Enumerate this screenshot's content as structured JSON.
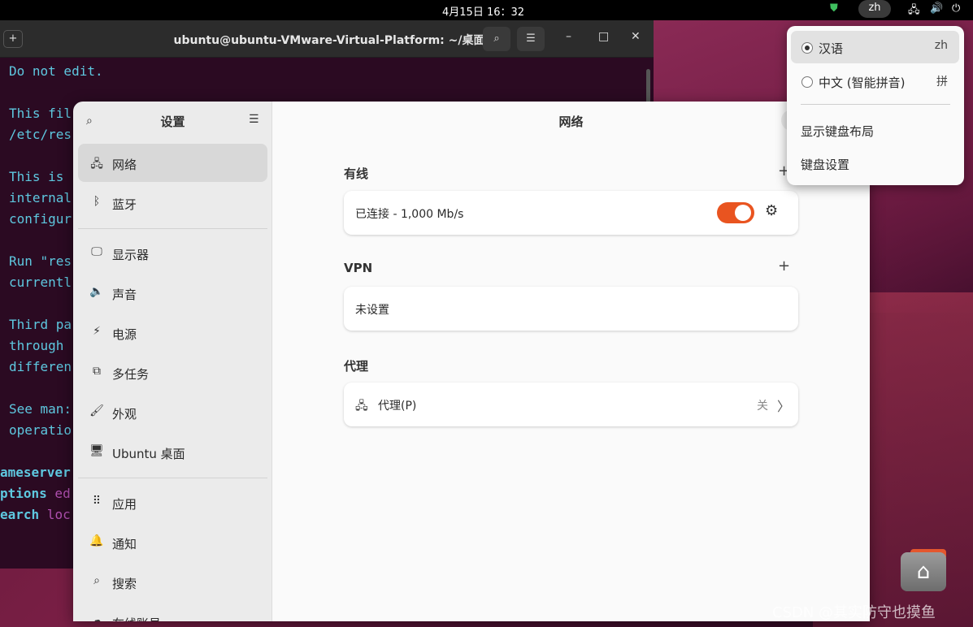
{
  "topbar": {
    "clock": "4月15日  16：32",
    "input_method": "zh"
  },
  "terminal": {
    "title": "ubuntu@ubuntu-VMware-Virtual-Platform: ~/桌面",
    "lines": [
      "Do not edit.",
      "",
      "This fil",
      "/etc/res",
      "",
      "This is ",
      "internal",
      "configur",
      "",
      "Run \"res",
      "currentl",
      "",
      "Third pa",
      "through ",
      "differen",
      "",
      "See man:",
      "operatio"
    ],
    "bold_lines": [
      {
        "kw": "ameserver",
        "val": ""
      },
      {
        "kw": "ptions",
        "val": " ed"
      },
      {
        "kw": "earch",
        "val": " loc"
      }
    ]
  },
  "settings": {
    "sidebar_title": "设置",
    "items": [
      {
        "label": "网络",
        "icon": "network-icon",
        "glyph": "🖧"
      },
      {
        "label": "蓝牙",
        "icon": "bluetooth-icon",
        "glyph": "ᛒ"
      },
      {
        "label": "显示器",
        "icon": "display-icon",
        "glyph": "🖵"
      },
      {
        "label": "声音",
        "icon": "sound-icon",
        "glyph": "🔈"
      },
      {
        "label": "电源",
        "icon": "power-icon",
        "glyph": "⚡"
      },
      {
        "label": "多任务",
        "icon": "multitasking-icon",
        "glyph": "⧉"
      },
      {
        "label": "外观",
        "icon": "appearance-icon",
        "glyph": "🖌"
      },
      {
        "label": "Ubuntu 桌面",
        "icon": "ubuntu-desktop-icon",
        "glyph": "🖥"
      },
      {
        "label": "应用",
        "icon": "apps-icon",
        "glyph": "⠿"
      },
      {
        "label": "通知",
        "icon": "notifications-icon",
        "glyph": "🔔"
      },
      {
        "label": "搜索",
        "icon": "search-icon",
        "glyph": "⌕"
      },
      {
        "label": "在线账号",
        "icon": "online-accounts-icon",
        "glyph": "☁"
      }
    ],
    "page_title": "网络",
    "wired": {
      "heading": "有线",
      "status": "已连接 - 1,000 Mb/s"
    },
    "vpn": {
      "heading": "VPN",
      "status": "未设置"
    },
    "proxy": {
      "heading": "代理",
      "label": "代理(P)",
      "value": "关"
    }
  },
  "popup": {
    "items": [
      {
        "label": "汉语",
        "short": "zh",
        "selected": true
      },
      {
        "label": "中文 (智能拼音)",
        "short": "拼",
        "selected": false
      }
    ],
    "show_layout": "显示键盘布局",
    "keyboard_settings": "键盘设置"
  },
  "watermark": "CSDN @其实防守也摸鱼",
  "colors": {
    "accent": "#e95420",
    "terminal_text": "#5ec8e0",
    "terminal_bg": "#2b0a22"
  }
}
